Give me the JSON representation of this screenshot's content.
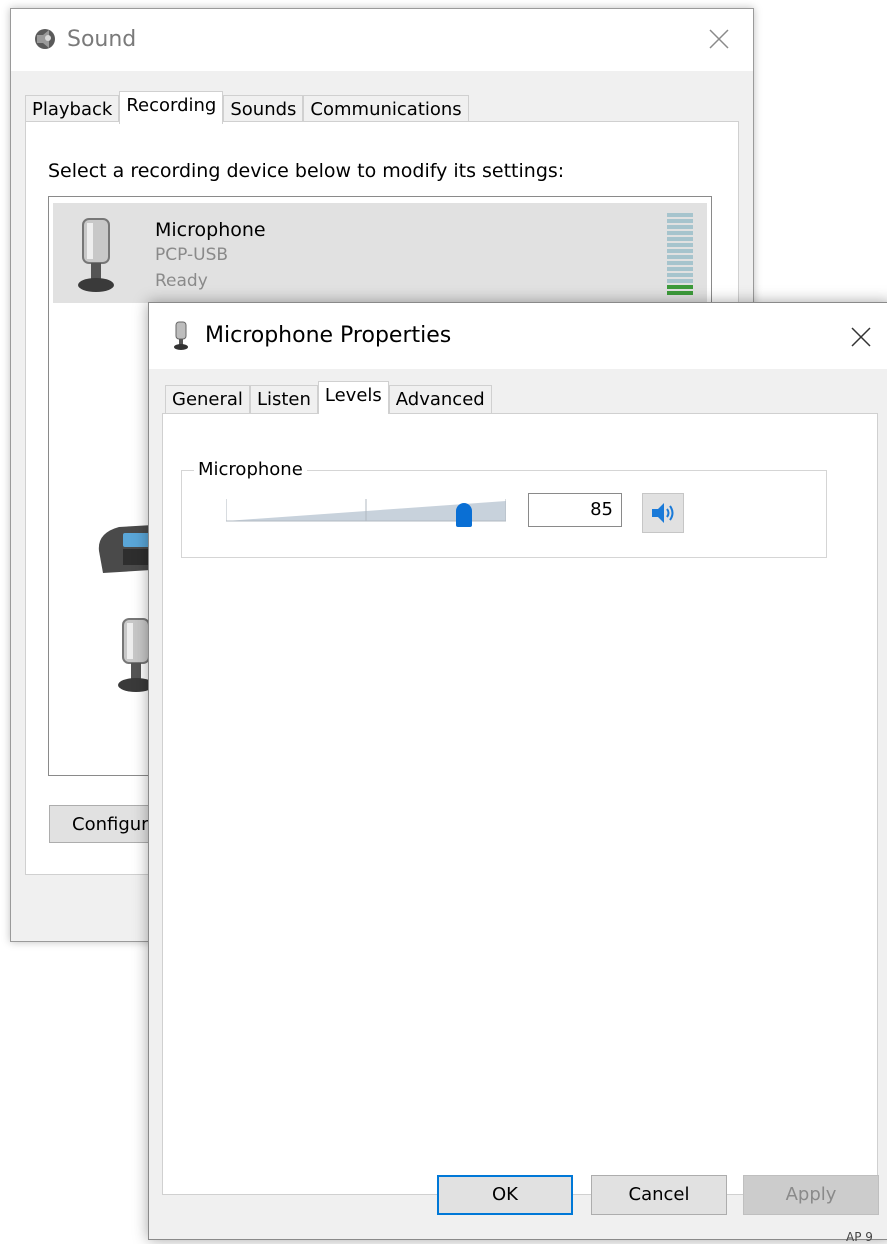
{
  "sound_window": {
    "title": "Sound",
    "tabs": [
      {
        "label": "Playback"
      },
      {
        "label": "Recording"
      },
      {
        "label": "Sounds"
      },
      {
        "label": "Communications"
      }
    ],
    "instructions": "Select a recording device below to modify its settings:",
    "devices": [
      {
        "name": "Microphone",
        "device": "PCP-USB",
        "status": "Ready",
        "level_segments": 14,
        "active_segments": 2
      }
    ],
    "configure_label": "Configur"
  },
  "props_window": {
    "title": "Microphone Properties",
    "tabs": [
      {
        "label": "General"
      },
      {
        "label": "Listen"
      },
      {
        "label": "Levels"
      },
      {
        "label": "Advanced"
      }
    ],
    "levels_group_label": "Microphone",
    "level_value": "85",
    "level_fraction": 0.85,
    "buttons": {
      "ok": "OK",
      "cancel": "Cancel",
      "apply": "Apply"
    }
  },
  "colors": {
    "accent": "#0078d7",
    "slider_thumb": "#0a6fd4",
    "level_on": "#3d9b3b",
    "level_off": "#a6c4cd"
  },
  "corner_text": "AP 9"
}
